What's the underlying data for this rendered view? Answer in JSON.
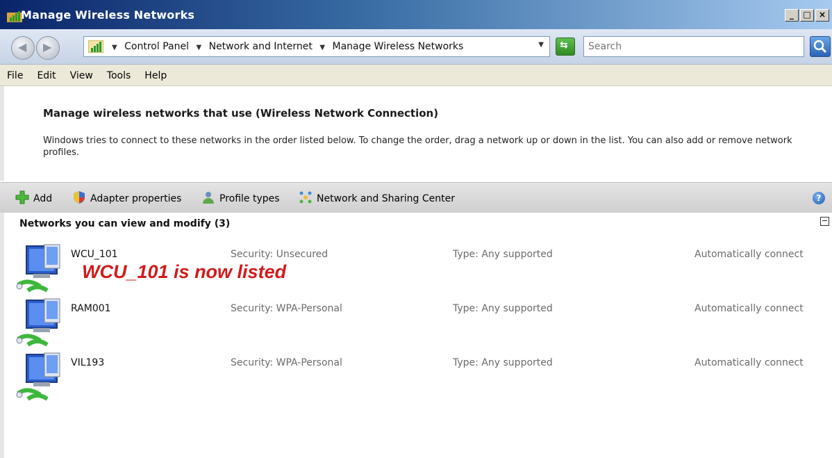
{
  "window": {
    "title": "Manage Wireless Networks",
    "controls": [
      "_",
      "□",
      "×"
    ]
  },
  "address": {
    "crumbs": [
      "Control Panel",
      "Network and Internet",
      "Manage Wireless Networks"
    ],
    "search_placeholder": "Search"
  },
  "menu": [
    "File",
    "Edit",
    "View",
    "Tools",
    "Help"
  ],
  "header": {
    "title": "Manage wireless networks that use (Wireless Network Connection)",
    "description": "Windows tries to connect to these networks in the order listed below. To change the order, drag a network up or down in the list. You can also add or remove network profiles."
  },
  "commands": {
    "add": "Add",
    "adapter_properties": "Adapter properties",
    "profile_types": "Profile types",
    "network_sharing": "Network and Sharing Center",
    "help": "?"
  },
  "list": {
    "group_header": "Networks you can view and modify (3)",
    "collapse_symbol": "−",
    "networks": [
      {
        "name": "WCU_101",
        "security": "Security: Unsecured",
        "type": "Type: Any supported",
        "connect": "Automatically connect"
      },
      {
        "name": "RAM001",
        "security": "Security: WPA-Personal",
        "type": "Type: Any supported",
        "connect": "Automatically connect"
      },
      {
        "name": "VIL193",
        "security": "Security: WPA-Personal",
        "type": "Type: Any supported",
        "connect": "Automatically connect"
      }
    ],
    "annotation": "WCU_101 is now listed"
  }
}
